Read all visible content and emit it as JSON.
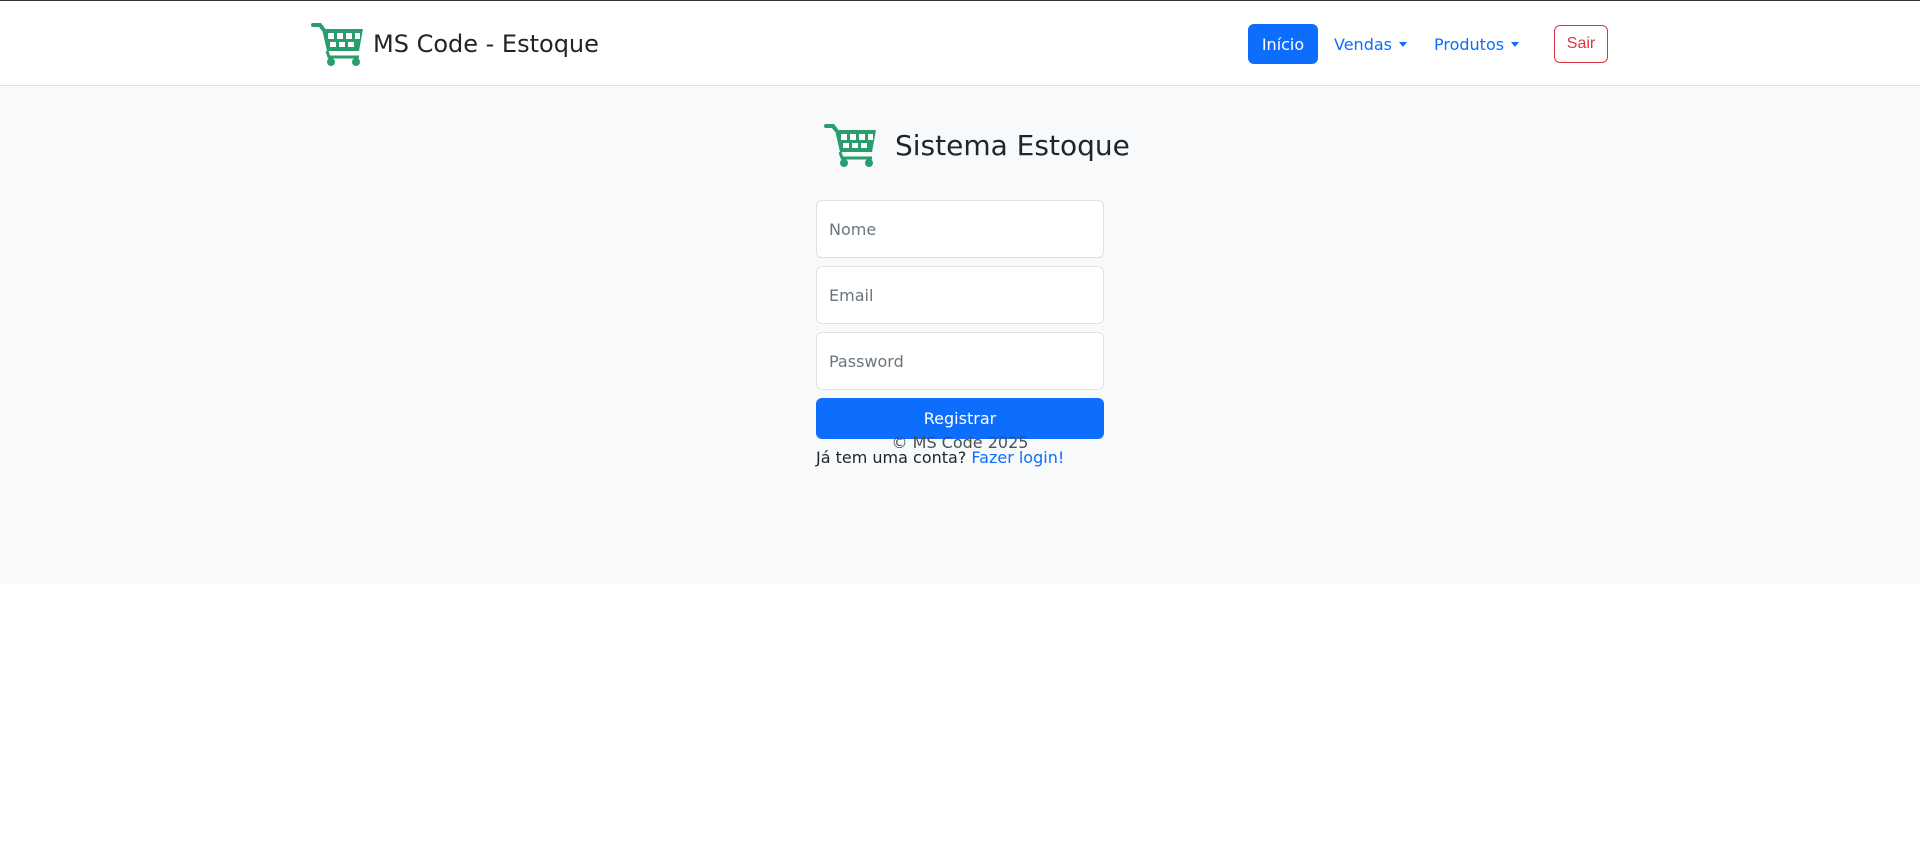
{
  "navbar": {
    "brand_icon": "shopping-cart-icon",
    "brand_text": "MS Code - Estoque",
    "items": [
      {
        "label": "Início",
        "active": true
      },
      {
        "label": "Vendas",
        "dropdown": true
      },
      {
        "label": "Produtos",
        "dropdown": true
      }
    ],
    "logout_label": "Sair"
  },
  "register": {
    "logo_icon": "shopping-cart-icon",
    "title": "Sistema Estoque",
    "name_placeholder": "Nome",
    "email_placeholder": "Email",
    "password_placeholder": "Password",
    "submit_label": "Registrar",
    "login_prompt": "Já tem uma conta?",
    "login_link": "Fazer login!"
  },
  "footer": {
    "text": "© MS Code 2025"
  },
  "colors": {
    "primary": "#0d6efd",
    "danger": "#dc3545",
    "cart_green": "#2a9d6e",
    "page_bg": "#f8f9fa"
  }
}
